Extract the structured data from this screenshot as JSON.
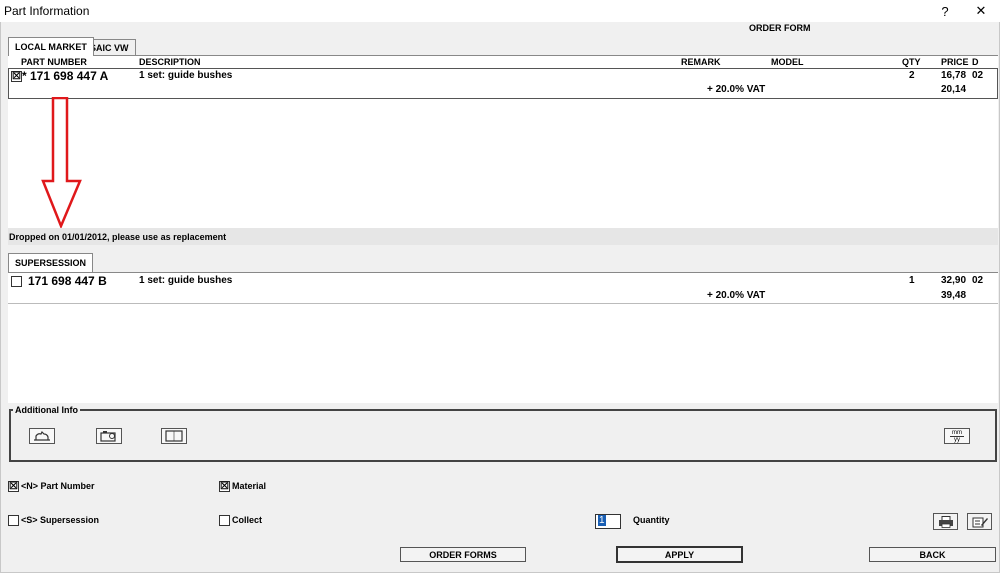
{
  "window": {
    "title": "Part Information",
    "help_label": "?",
    "close_label": "✕"
  },
  "header": {
    "order_form": "ORDER FORM"
  },
  "tabs": [
    {
      "label": "LOCAL MARKET",
      "active": true
    },
    {
      "label": "SAIC VW",
      "active": false
    }
  ],
  "columns": {
    "part_number": "PART NUMBER",
    "description": "DESCRIPTION",
    "remark": "REMARK",
    "model": "MODEL",
    "qty": "QTY",
    "price": "PRICE",
    "d": "D"
  },
  "main_part": {
    "checkbox": "☒",
    "part_number": "* 171 698 447 A",
    "description": "1 set: guide bushes",
    "qty": "2",
    "price": "16,78",
    "d": "02",
    "vat_label": "+ 20.0% VAT",
    "price_with_vat": "20,14"
  },
  "info_line": "Dropped on 01/01/2012, please use as replacement",
  "supersession_tab": "SUPERSESSION",
  "supersession_part": {
    "part_number": "171 698 447 B",
    "description": "1 set: guide bushes",
    "qty": "1",
    "price": "32,90",
    "d": "02",
    "vat_label": "+ 20.0% VAT",
    "price_with_vat": "39,48"
  },
  "additional_info": {
    "label": "Additional Info",
    "mm_label": "mm",
    "yy_label": "yy"
  },
  "options": {
    "part_number_label": "<N> Part Number",
    "material_label": "Material",
    "supersession_label": "<S> Supersession",
    "collect_label": "Collect",
    "quantity_label": "Quantity",
    "quantity_value": "1"
  },
  "buttons": {
    "order_forms": "ORDER FORMS",
    "apply": "APPLY",
    "back": "BACK"
  },
  "colors": {
    "arrow": "#e0181b"
  }
}
